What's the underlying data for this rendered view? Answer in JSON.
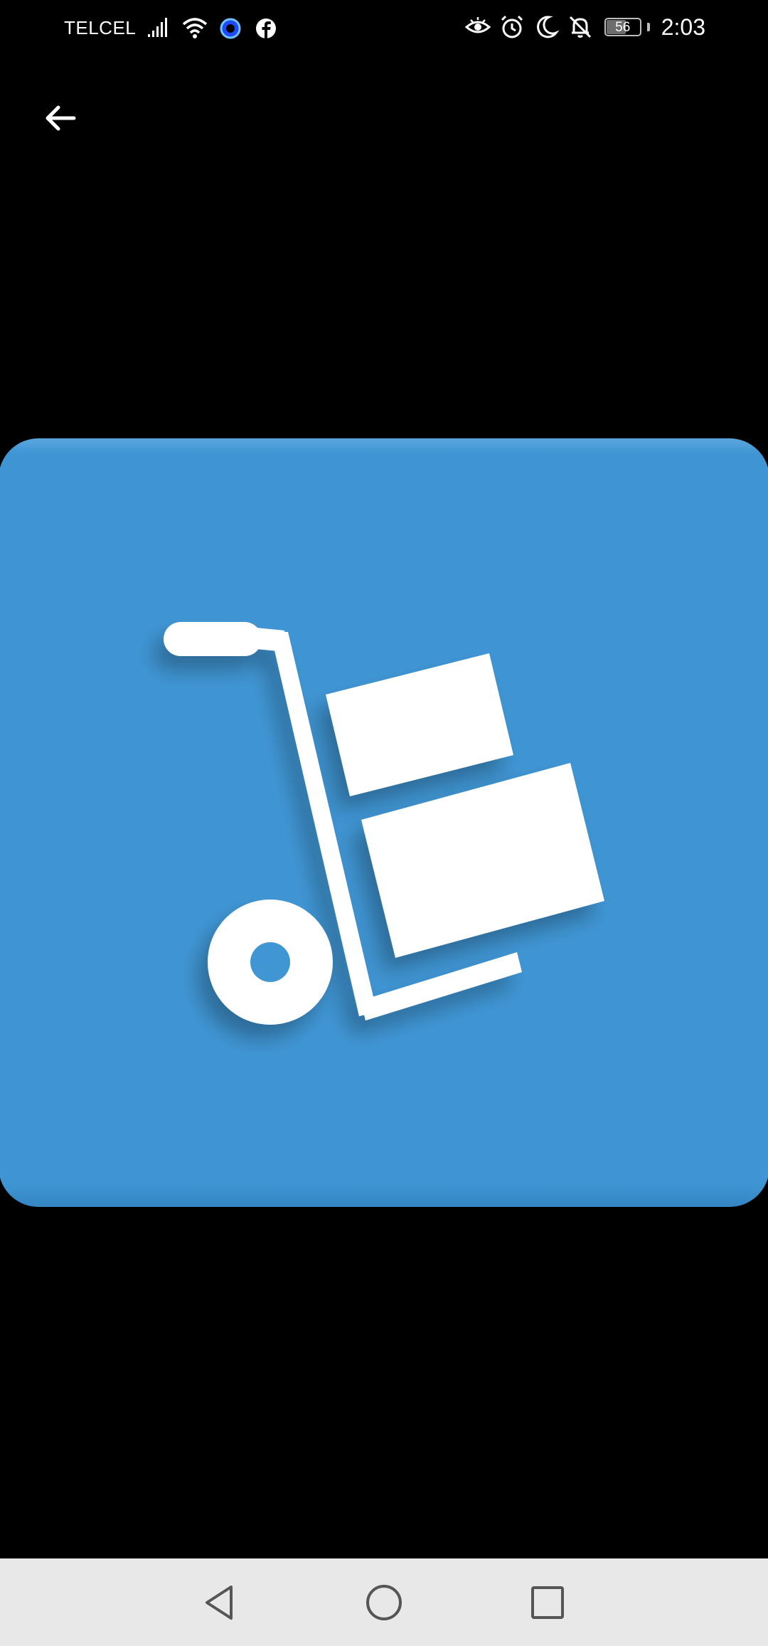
{
  "status_bar": {
    "carrier": "TELCEL",
    "battery_level": "56",
    "time": "2:03",
    "left_icons": [
      "signal-icon",
      "wifi-icon",
      "circle-app-icon",
      "facebook-icon"
    ],
    "right_icons": [
      "eye-icon",
      "alarm-icon",
      "moon-icon",
      "bell-off-icon"
    ]
  },
  "toolbar": {
    "back_icon": "arrow-left-icon"
  },
  "image": {
    "subject": "hand-truck-with-boxes-icon",
    "background_color": "#3f95d3",
    "icon_color": "#ffffff"
  },
  "nav_bar": {
    "buttons": [
      "back-triangle-icon",
      "home-circle-icon",
      "recents-square-icon"
    ]
  },
  "colors": {
    "screen_background": "#000000",
    "nav_background": "#e8e8e8",
    "nav_icon": "#555555"
  }
}
